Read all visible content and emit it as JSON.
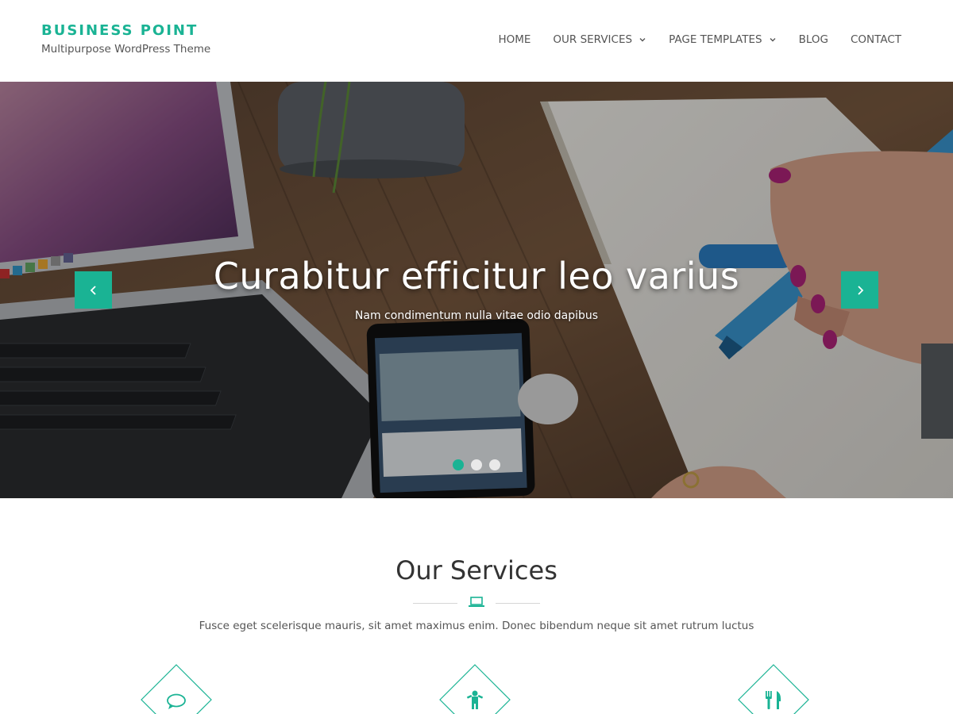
{
  "header": {
    "site_title": "BUSINESS POINT",
    "tagline": "Multipurpose WordPress Theme",
    "nav": [
      {
        "label": "HOME",
        "has_dropdown": false
      },
      {
        "label": "OUR SERVICES",
        "has_dropdown": true
      },
      {
        "label": "PAGE TEMPLATES",
        "has_dropdown": true
      },
      {
        "label": "BLOG",
        "has_dropdown": false
      },
      {
        "label": "CONTACT",
        "has_dropdown": false
      }
    ]
  },
  "hero": {
    "title": "Curabitur efficitur leo varius",
    "subtitle": "Nam condimentum nulla vitae odio dapibus",
    "prev_icon": "chevron-left-icon",
    "next_icon": "chevron-right-icon",
    "slide_count": 3,
    "active_slide": 1
  },
  "services": {
    "title": "Our Services",
    "divider_icon": "laptop-icon",
    "description": "Fusce eget scelerisque mauris, sit amet maximus enim. Donec bibendum neque sit amet rutrum luctus",
    "items": [
      {
        "icon": "chat-bubble-icon"
      },
      {
        "icon": "child-icon"
      },
      {
        "icon": "cutlery-icon"
      }
    ]
  },
  "colors": {
    "accent": "#1ab394",
    "text": "#555555",
    "heading": "#333333"
  }
}
